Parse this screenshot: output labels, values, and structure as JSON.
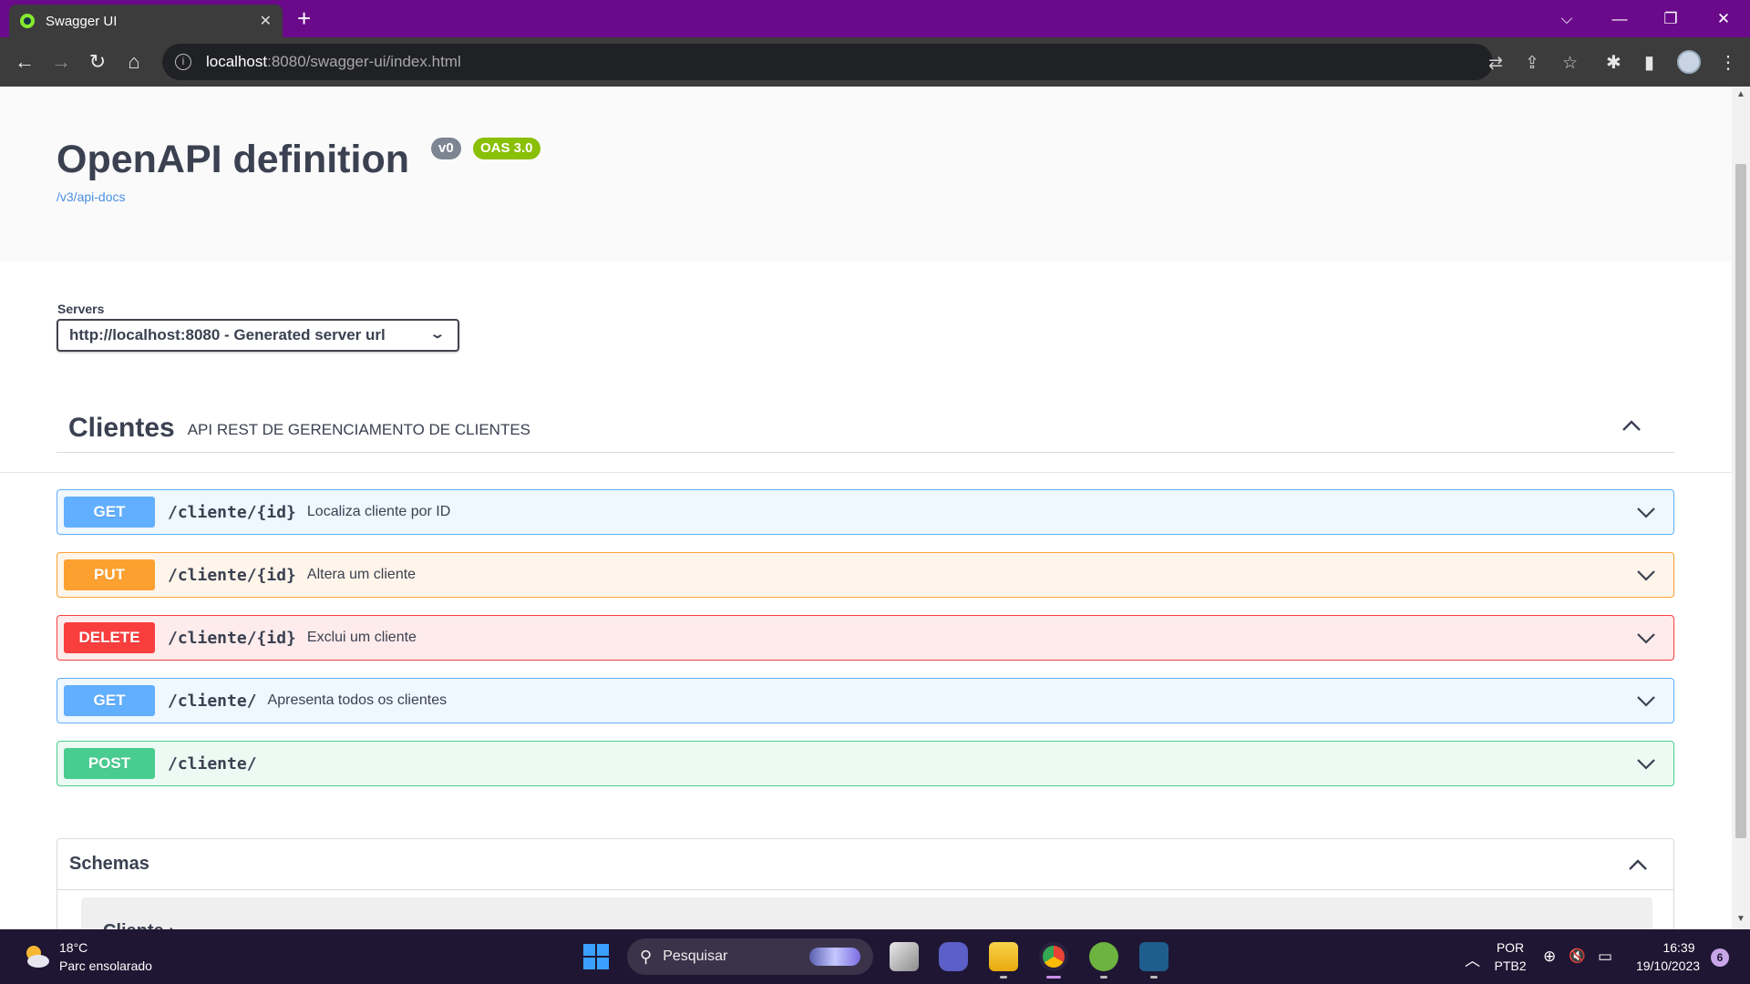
{
  "browser": {
    "tab_title": "Swagger UI",
    "tab_close": "✕",
    "new_tab": "+",
    "url_host": "localhost",
    "url_rest": ":8080/swagger-ui/index.html",
    "window_controls": {
      "dropdown": "⌵",
      "minimize": "—",
      "restore": "❐",
      "close": "✕"
    },
    "nav": {
      "back": "←",
      "forward": "→",
      "reload": "↻",
      "home": "⌂"
    },
    "info_glyph": "i",
    "toolbar_icons": {
      "translate": "⇄",
      "share": "⇪",
      "bookmark": "☆",
      "extensions": "✱",
      "sidepanel": "▮",
      "menu": "⋮"
    }
  },
  "api": {
    "title": "OpenAPI definition",
    "version_badge": "v0",
    "oas_badge": "OAS 3.0",
    "docs_link": "/v3/api-docs"
  },
  "servers": {
    "label": "Servers",
    "selected": "http://localhost:8080 - Generated server url",
    "chevron": "⌄"
  },
  "tag": {
    "name": "Clientes",
    "description": "API REST DE GERENCIAMENTO DE CLIENTES"
  },
  "operations": [
    {
      "method": "GET",
      "path": "/cliente/{id}",
      "summary": "Localiza cliente por ID"
    },
    {
      "method": "PUT",
      "path": "/cliente/{id}",
      "summary": "Altera um cliente"
    },
    {
      "method": "DELETE",
      "path": "/cliente/{id}",
      "summary": "Exclui um cliente"
    },
    {
      "method": "GET",
      "path": "/cliente/",
      "summary": "Apresenta todos os clientes"
    },
    {
      "method": "POST",
      "path": "/cliente/",
      "summary": ""
    }
  ],
  "schemas": {
    "title": "Schemas",
    "model_name": "Cliente ›"
  },
  "taskbar": {
    "temperature": "18°C",
    "weather": "Parc ensolarado",
    "search_placeholder": "Pesquisar",
    "search_glyph": "⚲",
    "lang_top": "POR",
    "lang_bottom": "PTB2",
    "time": "16:39",
    "date": "19/10/2023",
    "notifications": "6",
    "tray_glyphs": {
      "chevron_up": "︿",
      "network": "⊕",
      "volume": "🔇",
      "battery": "▭"
    }
  },
  "colors": {
    "get": "#61affe",
    "put": "#fca130",
    "delete": "#f93e3e",
    "post": "#49cc90",
    "browser_tabbar": "#6a0a8a",
    "text": "#3b4151"
  }
}
